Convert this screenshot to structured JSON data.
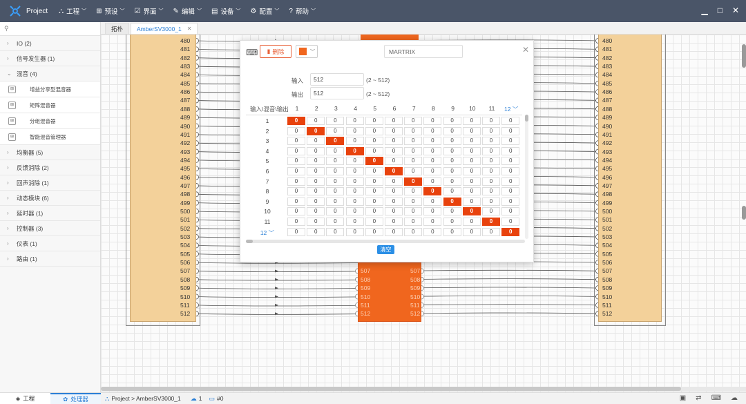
{
  "app": {
    "title": "Project"
  },
  "menu": [
    {
      "label": "工程",
      "icon": "sitemap-icon",
      "glyph": "⛬"
    },
    {
      "label": "预设",
      "icon": "grid-icon",
      "glyph": "⊞"
    },
    {
      "label": "界面",
      "icon": "checkbox-icon",
      "glyph": "☑"
    },
    {
      "label": "编辑",
      "icon": "edit-icon",
      "glyph": "✎"
    },
    {
      "label": "设备",
      "icon": "device-icon",
      "glyph": "▤"
    },
    {
      "label": "配置",
      "icon": "config-icon",
      "glyph": "⚙"
    },
    {
      "label": "帮助",
      "icon": "help-icon",
      "glyph": "?"
    }
  ],
  "sidebar": {
    "groups": [
      {
        "label": "IO (2)",
        "expanded": false
      },
      {
        "label": "信号发生器 (1)",
        "expanded": false
      },
      {
        "label": "混音 (4)",
        "expanded": true
      },
      {
        "label": "均衡器 (5)",
        "expanded": false
      },
      {
        "label": "反馈消除 (2)",
        "expanded": false
      },
      {
        "label": "回声消除 (1)",
        "expanded": false
      },
      {
        "label": "动态模块 (6)",
        "expanded": false
      },
      {
        "label": "延时器 (1)",
        "expanded": false
      },
      {
        "label": "控制器 (3)",
        "expanded": false
      },
      {
        "label": "仪表 (1)",
        "expanded": false
      },
      {
        "label": "路由 (1)",
        "expanded": false
      }
    ],
    "mixer_items": [
      "增益分享型混音器",
      "矩阵混音器",
      "分组混音器",
      "智能混音管理器"
    ],
    "bottom_tabs": [
      {
        "label": "工程",
        "active": false
      },
      {
        "label": "处理器",
        "active": true
      }
    ]
  },
  "tabs": [
    {
      "label": "拓朴",
      "active": false
    },
    {
      "label": "AmberSV3000_1",
      "active": true
    }
  ],
  "canvas": {
    "left_ports": [
      "480",
      "481",
      "482",
      "483",
      "484",
      "485",
      "486",
      "487",
      "488",
      "489",
      "490",
      "491",
      "492",
      "493",
      "494",
      "495",
      "496",
      "497",
      "498",
      "499",
      "500",
      "501",
      "502",
      "503",
      "504",
      "505",
      "506",
      "507",
      "508",
      "509",
      "510",
      "511",
      "512"
    ],
    "mid_ports": [
      "507",
      "508",
      "509",
      "510",
      "511",
      "512"
    ]
  },
  "dialog": {
    "delete_label": "删除",
    "color": "#f0661e",
    "name": "MARTRIX",
    "input_label": "输入",
    "input_value": "512",
    "input_range": "(2 ~ 512)",
    "output_label": "输出",
    "output_value": "512",
    "output_range": "(2 ~ 512)",
    "matrix_header": "输入\\混音\\输出",
    "cols": [
      "1",
      "2",
      "3",
      "4",
      "5",
      "6",
      "7",
      "8",
      "9",
      "10",
      "11",
      "12"
    ],
    "rows": [
      "1",
      "2",
      "3",
      "4",
      "5",
      "6",
      "7",
      "8",
      "9",
      "10",
      "11",
      "12"
    ],
    "cell_value": "0",
    "clear_label": "清空"
  },
  "statusbar": {
    "breadcrumb": "Project > AmberSV3000_1",
    "count1": "1",
    "count2": "#0"
  }
}
